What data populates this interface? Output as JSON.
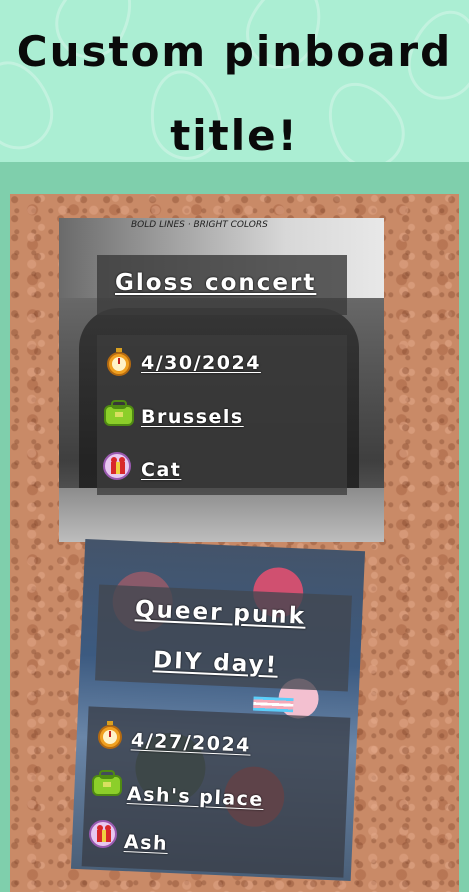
{
  "header": {
    "title_line1": "Custom pinboard",
    "title_line2": "title!"
  },
  "colors": {
    "header_bg": "#abeed3",
    "band": "#7fcfac",
    "cork": "#c98a67"
  },
  "events": [
    {
      "title": "Gloss concert",
      "date": "4/30/2024",
      "location": "Brussels",
      "host": "Cat",
      "photo_sign": "BOLD LINES · BRIGHT COLORS"
    },
    {
      "title_line1": "Queer punk",
      "title_line2": "DIY day!",
      "date": "4/27/2024",
      "location": "Ash's place",
      "host": "Ash"
    }
  ],
  "icons": {
    "date": "stopwatch-icon",
    "location": "green-bag-icon",
    "host": "gift-icon"
  }
}
